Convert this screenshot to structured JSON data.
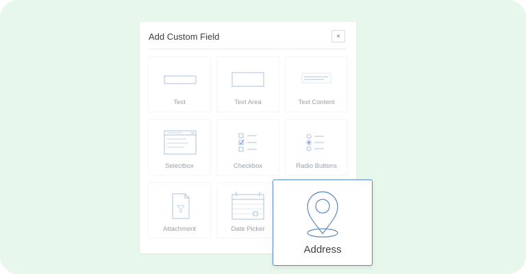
{
  "dialog": {
    "title": "Add Custom Field",
    "close_glyph": "×"
  },
  "fields": [
    {
      "label": "Text",
      "icon": "text-field-icon"
    },
    {
      "label": "Text Area",
      "icon": "text-area-icon"
    },
    {
      "label": "Text Content",
      "icon": "text-content-icon"
    },
    {
      "label": "Selectbox",
      "icon": "selectbox-icon"
    },
    {
      "label": "Checkbox",
      "icon": "checkbox-icon"
    },
    {
      "label": "Radio Buttons",
      "icon": "radio-buttons-icon"
    },
    {
      "label": "Attachment",
      "icon": "attachment-icon"
    },
    {
      "label": "Date Picker",
      "icon": "date-picker-icon"
    }
  ],
  "highlight": {
    "label": "Address",
    "icon": "map-pin-icon"
  },
  "colors": {
    "background": "#e8f7ec",
    "icon_stroke": "#a9c0de",
    "accent": "#5b86c4"
  }
}
